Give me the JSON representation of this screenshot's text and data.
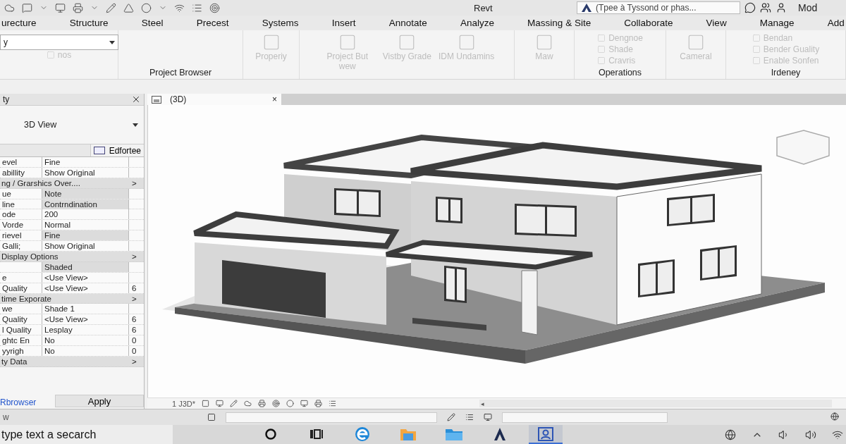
{
  "title_bar": {
    "title": "Revt",
    "search": {
      "placeholder": "(Tpee à Tyssond or phas..."
    },
    "user_menu": "Mod"
  },
  "ribbon_tabs": [
    "urecture",
    "Structure",
    "Steel",
    "Precest",
    "Systems",
    "Insert",
    "Annotate",
    "Analyze",
    "Massing & Site",
    "Collaborate",
    "View",
    "Manage",
    "Add"
  ],
  "ribbon": {
    "type_dropdown": {
      "value": "y"
    },
    "panels": [
      {
        "items": [
          {
            "kind": "small",
            "label": "nos",
            "disabled": true
          }
        ]
      },
      {
        "label": "Project Browser"
      },
      {
        "items": [
          {
            "kind": "large",
            "label": "Properiy",
            "disabled": true
          }
        ]
      },
      {
        "items": [
          {
            "kind": "large",
            "label": "Project But wew",
            "disabled": true
          },
          {
            "kind": "large",
            "label": "Vistby Grade",
            "disabled": true
          },
          {
            "kind": "large",
            "label": "IDM Undamins",
            "disabled": true
          }
        ]
      },
      {
        "items": [
          {
            "kind": "large",
            "label": "Maw",
            "disabled": true
          }
        ]
      },
      {
        "label": "Operations",
        "items": [
          {
            "kind": "small",
            "label": "Dengnoe",
            "disabled": true
          },
          {
            "kind": "small",
            "label": "Shade",
            "disabled": true
          },
          {
            "kind": "small",
            "label": "Cravris",
            "disabled": true
          }
        ]
      },
      {
        "items": [
          {
            "kind": "large",
            "label": "Cameral",
            "disabled": true
          }
        ]
      },
      {
        "label": "Irdeney",
        "items": [
          {
            "kind": "small",
            "label": "Bendan",
            "disabled": true
          },
          {
            "kind": "small",
            "label": "Bender Guality",
            "disabled": true
          },
          {
            "kind": "small",
            "label": "Enable Sonfen",
            "disabled": true
          }
        ]
      }
    ]
  },
  "properties": {
    "title": "ty",
    "type_selector": "3D View",
    "edit_type": "Edfortee",
    "rows": [
      {
        "kind": "param",
        "name": "evel",
        "value": "Fine",
        "readonly": false
      },
      {
        "kind": "param",
        "name": "abillity",
        "value": "Show Original",
        "readonly": false
      },
      {
        "kind": "group",
        "name": "ng / Grarshics Over....",
        "toggle": ">"
      },
      {
        "kind": "param",
        "name": "ue",
        "value": "Note",
        "readonly": true
      },
      {
        "kind": "param",
        "name": "line",
        "value": "Contrndination",
        "readonly": true
      },
      {
        "kind": "param",
        "name": "ode",
        "value": "200",
        "readonly": false
      },
      {
        "kind": "param",
        "name": "Vorde",
        "value": "Normal",
        "readonly": false
      },
      {
        "kind": "param",
        "name": "rievel",
        "value": "Fine",
        "readonly": true
      },
      {
        "kind": "param",
        "name": "Galli;",
        "value": "Show Original",
        "readonly": false
      },
      {
        "kind": "group",
        "name": "Display Options",
        "toggle": ">"
      },
      {
        "kind": "param",
        "value": "Shaded",
        "readonly": true
      },
      {
        "kind": "param",
        "name": "e",
        "value": "<Use View>",
        "readonly": false
      },
      {
        "kind": "param",
        "name": "Quality",
        "value": "<Use View>",
        "extra": "6",
        "readonly": false
      },
      {
        "kind": "group",
        "name": "time Exporate",
        "toggle": ">"
      },
      {
        "kind": "param",
        "name": "we",
        "value": "Shade 1",
        "readonly": false
      },
      {
        "kind": "param",
        "name": "Quality",
        "value": "<Use View>",
        "extra": "6",
        "readonly": false
      },
      {
        "kind": "param",
        "name": "l Quality",
        "value": "Lesplay",
        "extra": "6",
        "readonly": false
      },
      {
        "kind": "param",
        "name": "ghtc En",
        "value": "No",
        "extra": "0",
        "readonly": false
      },
      {
        "kind": "param",
        "name": "yyrigh",
        "value": "No",
        "extra": "0",
        "readonly": false
      },
      {
        "kind": "group",
        "name": "ty Data",
        "toggle": ">"
      }
    ],
    "footer": {
      "link": "Rbrowser",
      "apply": "Apply"
    }
  },
  "view_tabs": [
    {
      "label": "(3D)",
      "close": "×",
      "selected": true
    }
  ],
  "view_bar": {
    "scale": "1 J3D*",
    "scroll": "◂"
  },
  "status_bar": {
    "text": "w"
  },
  "taskbar": {
    "search": {
      "placeholder": "type text a secarch"
    },
    "apps": [
      {
        "kind": "search",
        "selected": false
      },
      {
        "kind": "tasks",
        "selected": false
      },
      {
        "kind": "browser",
        "selected": false
      },
      {
        "kind": "folder",
        "selected": false
      },
      {
        "kind": "files",
        "selected": false
      },
      {
        "kind": "a-app",
        "selected": false
      },
      {
        "kind": "person-app",
        "selected": true
      }
    ]
  }
}
